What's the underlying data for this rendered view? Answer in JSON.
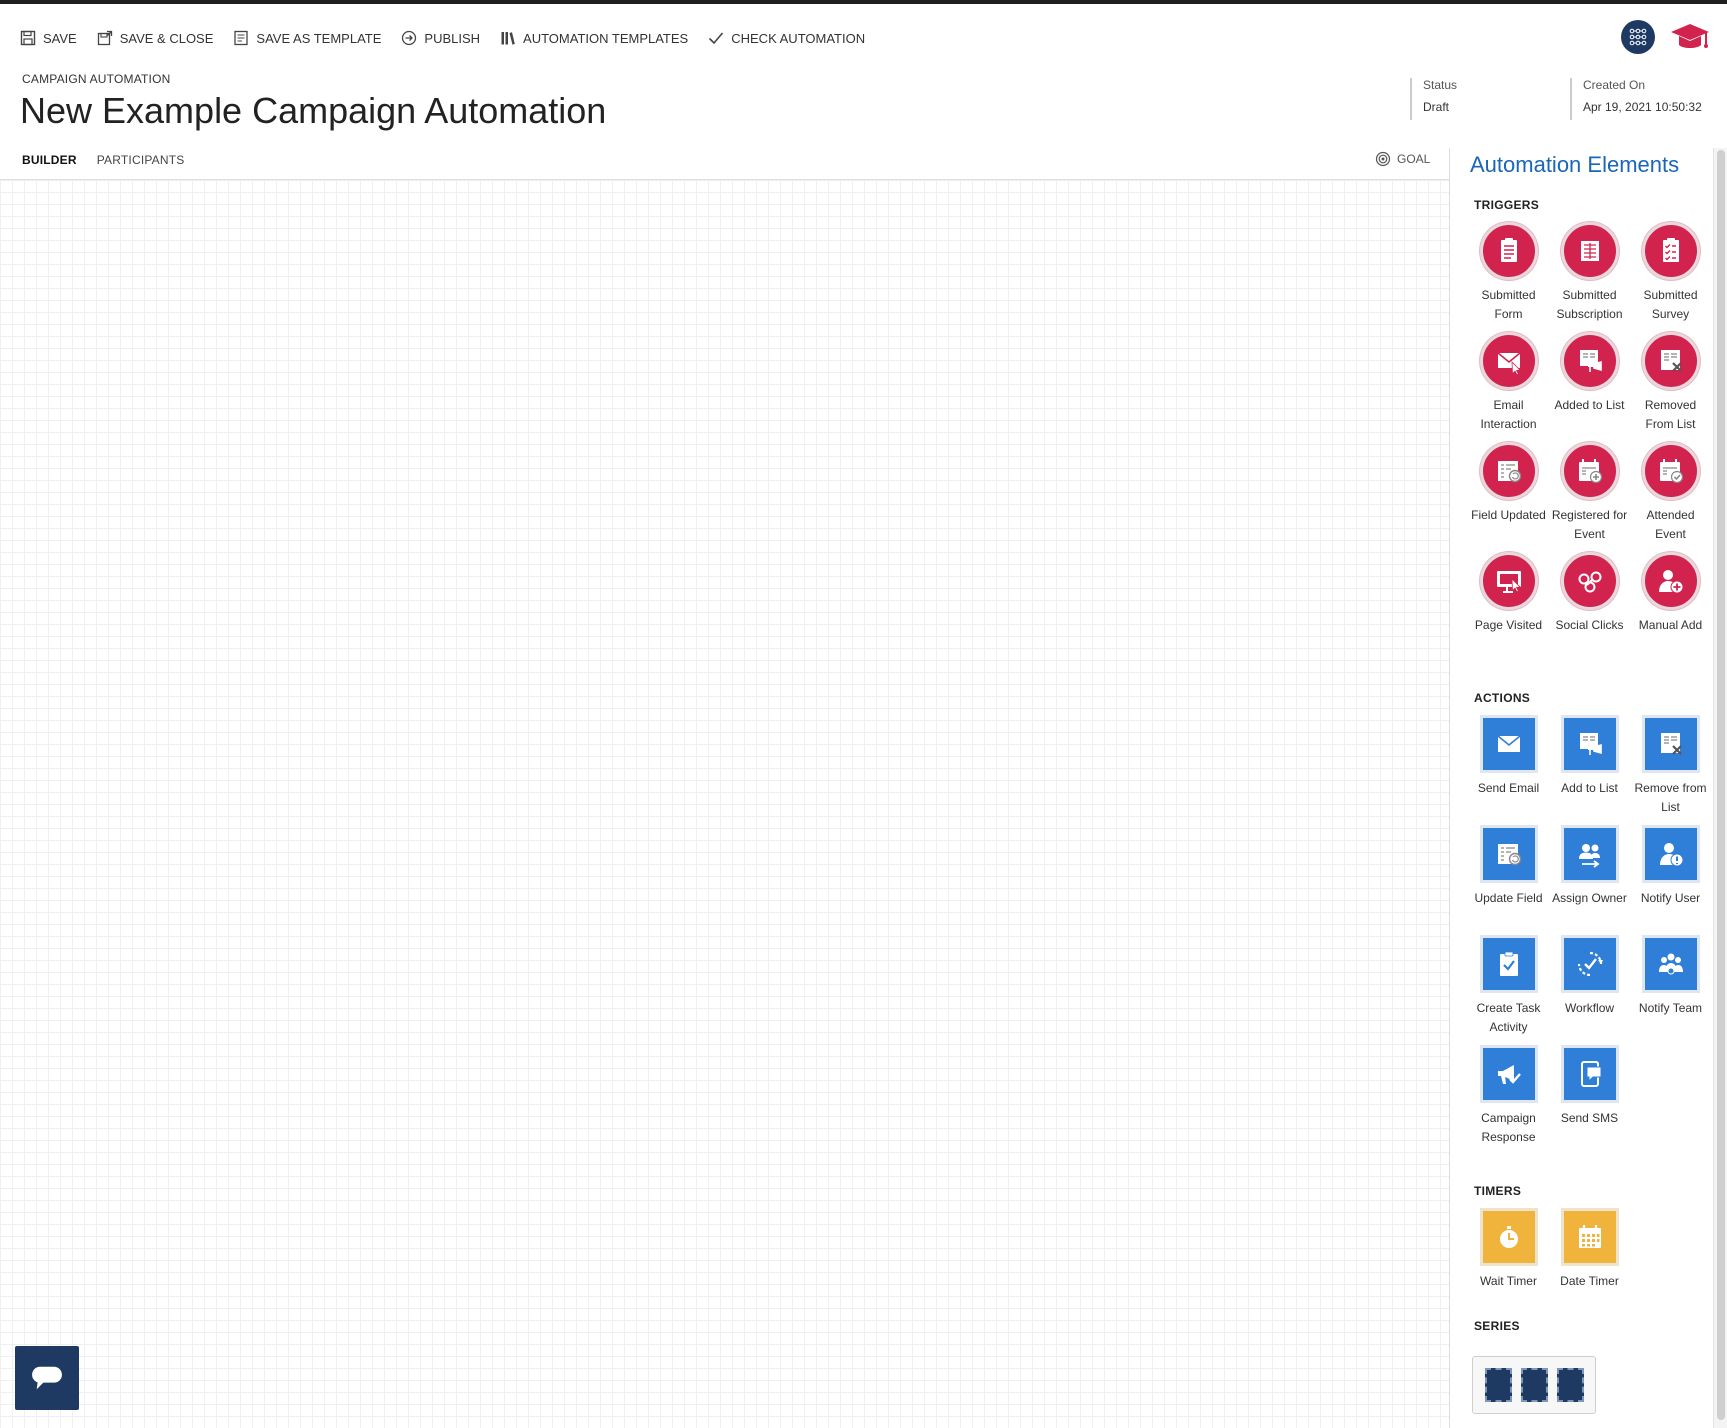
{
  "toolbar": {
    "save": "SAVE",
    "save_close": "SAVE & CLOSE",
    "save_template": "SAVE AS TEMPLATE",
    "publish": "PUBLISH",
    "automation_templates": "AUTOMATION TEMPLATES",
    "check_automation": "CHECK AUTOMATION"
  },
  "header": {
    "breadcrumb": "CAMPAIGN AUTOMATION",
    "title": "New Example Campaign Automation",
    "status_label": "Status",
    "status_value": "Draft",
    "created_label": "Created On",
    "created_value": "Apr 19, 2021 10:50:32"
  },
  "tabs": {
    "builder": "BUILDER",
    "participants": "PARTICIPANTS",
    "goal": "GOAL"
  },
  "panel": {
    "title": "Automation Elements",
    "triggers_title": "TRIGGERS",
    "actions_title": "ACTIONS",
    "timers_title": "TIMERS",
    "series_title": "SERIES",
    "triggers": [
      {
        "label": "Submitted Form",
        "icon": "form-icon"
      },
      {
        "label": "Submitted Subscription",
        "icon": "subscription-icon"
      },
      {
        "label": "Submitted Survey",
        "icon": "survey-icon"
      },
      {
        "label": "Email Interaction",
        "icon": "email-click-icon"
      },
      {
        "label": "Added to List",
        "icon": "list-add-icon"
      },
      {
        "label": "Removed From List",
        "icon": "list-remove-icon"
      },
      {
        "label": "Field Updated",
        "icon": "field-update-icon"
      },
      {
        "label": "Registered for Event",
        "icon": "event-register-icon"
      },
      {
        "label": "Attended Event",
        "icon": "event-attend-icon"
      },
      {
        "label": "Page Visited",
        "icon": "page-visit-icon"
      },
      {
        "label": "Social Clicks",
        "icon": "social-icon"
      },
      {
        "label": "Manual Add",
        "icon": "user-add-icon"
      }
    ],
    "actions": [
      {
        "label": "Send Email",
        "icon": "envelope-icon"
      },
      {
        "label": "Add to List",
        "icon": "list-add-icon"
      },
      {
        "label": "Remove from List",
        "icon": "list-remove-icon"
      },
      {
        "label": "Update Field",
        "icon": "field-update-icon"
      },
      {
        "label": "Assign Owner",
        "icon": "assign-owner-icon"
      },
      {
        "label": "Notify User",
        "icon": "notify-user-icon"
      },
      {
        "label": "Create Task Activity",
        "icon": "task-icon"
      },
      {
        "label": "Workflow",
        "icon": "workflow-icon"
      },
      {
        "label": "Notify Team",
        "icon": "team-icon"
      },
      {
        "label": "Campaign Response",
        "icon": "megaphone-icon"
      },
      {
        "label": "Send SMS",
        "icon": "sms-icon"
      }
    ],
    "timers": [
      {
        "label": "Wait Timer",
        "icon": "stopwatch-icon"
      },
      {
        "label": "Date Timer",
        "icon": "calendar-icon"
      }
    ]
  },
  "colors": {
    "trigger": "#d1234e",
    "action": "#2f7ed8",
    "timer": "#f0b43d",
    "title_blue": "#1a66b8",
    "navy": "#1e3a63"
  }
}
